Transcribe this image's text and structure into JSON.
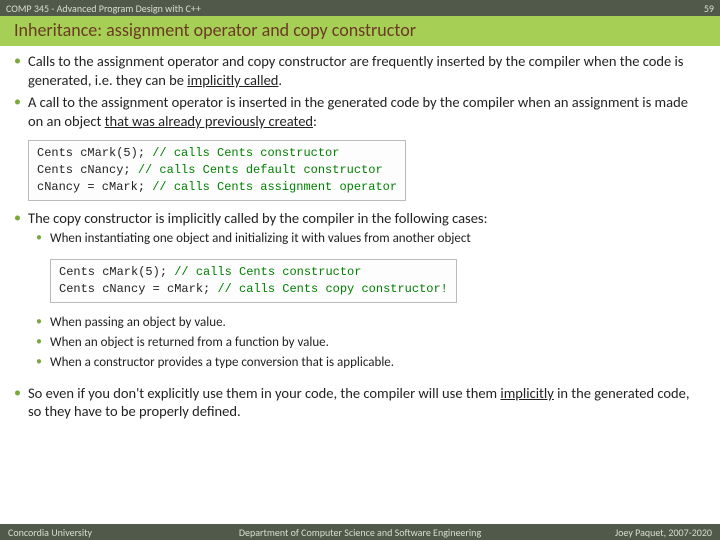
{
  "header": {
    "course": "COMP 345 - Advanced Program Design with C++",
    "slide_number": "59",
    "title": "Inheritance: assignment operator and copy constructor"
  },
  "bullets": {
    "b1_pre": "Calls to the assignment operator and copy constructor are frequently inserted by the compiler when the code is generated, i.e. they can be ",
    "b1_u": "implicitly called",
    "b1_post": ".",
    "b2_pre": "A call to the assignment operator is inserted in the generated code by the compiler when an assignment is made on an object ",
    "b2_u": "that was already previously created",
    "b2_post": ":",
    "b3": "The copy constructor is implicitly called by the compiler in the following cases:",
    "s1": "When instantiating one object and initializing it with values from another object",
    "s2": "When passing an object by value.",
    "s3": "When an object is returned from a function by value.",
    "s4": "When a constructor provides a type conversion that is applicable.",
    "b4_pre": "So even if you don't explicitly use them in your code, the compiler will use them ",
    "b4_u": "implicitly",
    "b4_post": " in the generated code, so they have to be properly defined."
  },
  "code1": {
    "l1a": "Cents cMark(5); ",
    "l1c": "// calls Cents constructor",
    "l2a": "Cents cNancy; ",
    "l2c": "// calls Cents default constructor",
    "l3a": "cNancy = cMark; ",
    "l3c": "// calls Cents assignment operator"
  },
  "code2": {
    "l1a": "Cents cMark(5); ",
    "l1c": "// calls Cents constructor",
    "l2a": "Cents cNancy = cMark; ",
    "l2c": "// calls Cents copy constructor!"
  },
  "footer": {
    "left": "Concordia University",
    "mid": "Department of Computer Science and Software Engineering",
    "right": "Joey Paquet, 2007-2020"
  }
}
